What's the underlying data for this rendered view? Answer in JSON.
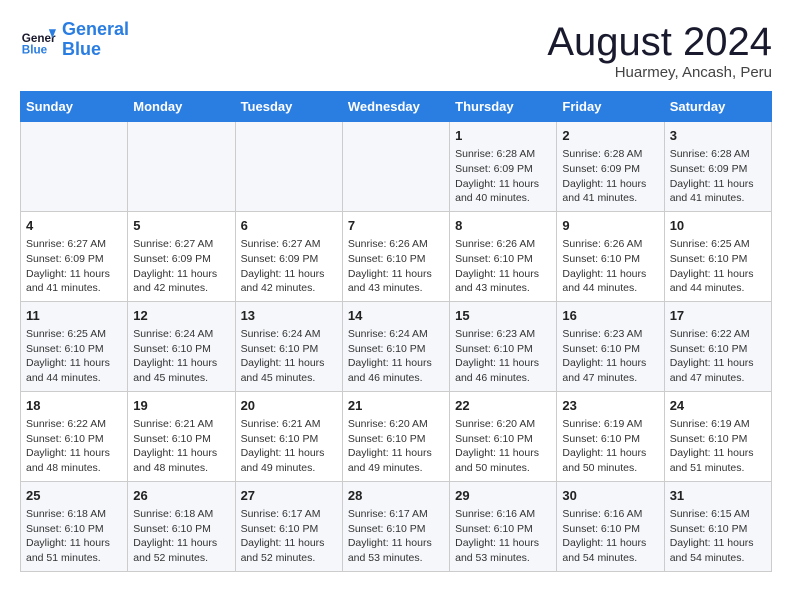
{
  "header": {
    "logo_line1": "General",
    "logo_line2": "Blue",
    "month_title": "August 2024",
    "subtitle": "Huarmey, Ancash, Peru"
  },
  "weekdays": [
    "Sunday",
    "Monday",
    "Tuesday",
    "Wednesday",
    "Thursday",
    "Friday",
    "Saturday"
  ],
  "weeks": [
    [
      {
        "day": "",
        "info": ""
      },
      {
        "day": "",
        "info": ""
      },
      {
        "day": "",
        "info": ""
      },
      {
        "day": "",
        "info": ""
      },
      {
        "day": "1",
        "info": "Sunrise: 6:28 AM\nSunset: 6:09 PM\nDaylight: 11 hours and 40 minutes."
      },
      {
        "day": "2",
        "info": "Sunrise: 6:28 AM\nSunset: 6:09 PM\nDaylight: 11 hours and 41 minutes."
      },
      {
        "day": "3",
        "info": "Sunrise: 6:28 AM\nSunset: 6:09 PM\nDaylight: 11 hours and 41 minutes."
      }
    ],
    [
      {
        "day": "4",
        "info": "Sunrise: 6:27 AM\nSunset: 6:09 PM\nDaylight: 11 hours and 41 minutes."
      },
      {
        "day": "5",
        "info": "Sunrise: 6:27 AM\nSunset: 6:09 PM\nDaylight: 11 hours and 42 minutes."
      },
      {
        "day": "6",
        "info": "Sunrise: 6:27 AM\nSunset: 6:09 PM\nDaylight: 11 hours and 42 minutes."
      },
      {
        "day": "7",
        "info": "Sunrise: 6:26 AM\nSunset: 6:10 PM\nDaylight: 11 hours and 43 minutes."
      },
      {
        "day": "8",
        "info": "Sunrise: 6:26 AM\nSunset: 6:10 PM\nDaylight: 11 hours and 43 minutes."
      },
      {
        "day": "9",
        "info": "Sunrise: 6:26 AM\nSunset: 6:10 PM\nDaylight: 11 hours and 44 minutes."
      },
      {
        "day": "10",
        "info": "Sunrise: 6:25 AM\nSunset: 6:10 PM\nDaylight: 11 hours and 44 minutes."
      }
    ],
    [
      {
        "day": "11",
        "info": "Sunrise: 6:25 AM\nSunset: 6:10 PM\nDaylight: 11 hours and 44 minutes."
      },
      {
        "day": "12",
        "info": "Sunrise: 6:24 AM\nSunset: 6:10 PM\nDaylight: 11 hours and 45 minutes."
      },
      {
        "day": "13",
        "info": "Sunrise: 6:24 AM\nSunset: 6:10 PM\nDaylight: 11 hours and 45 minutes."
      },
      {
        "day": "14",
        "info": "Sunrise: 6:24 AM\nSunset: 6:10 PM\nDaylight: 11 hours and 46 minutes."
      },
      {
        "day": "15",
        "info": "Sunrise: 6:23 AM\nSunset: 6:10 PM\nDaylight: 11 hours and 46 minutes."
      },
      {
        "day": "16",
        "info": "Sunrise: 6:23 AM\nSunset: 6:10 PM\nDaylight: 11 hours and 47 minutes."
      },
      {
        "day": "17",
        "info": "Sunrise: 6:22 AM\nSunset: 6:10 PM\nDaylight: 11 hours and 47 minutes."
      }
    ],
    [
      {
        "day": "18",
        "info": "Sunrise: 6:22 AM\nSunset: 6:10 PM\nDaylight: 11 hours and 48 minutes."
      },
      {
        "day": "19",
        "info": "Sunrise: 6:21 AM\nSunset: 6:10 PM\nDaylight: 11 hours and 48 minutes."
      },
      {
        "day": "20",
        "info": "Sunrise: 6:21 AM\nSunset: 6:10 PM\nDaylight: 11 hours and 49 minutes."
      },
      {
        "day": "21",
        "info": "Sunrise: 6:20 AM\nSunset: 6:10 PM\nDaylight: 11 hours and 49 minutes."
      },
      {
        "day": "22",
        "info": "Sunrise: 6:20 AM\nSunset: 6:10 PM\nDaylight: 11 hours and 50 minutes."
      },
      {
        "day": "23",
        "info": "Sunrise: 6:19 AM\nSunset: 6:10 PM\nDaylight: 11 hours and 50 minutes."
      },
      {
        "day": "24",
        "info": "Sunrise: 6:19 AM\nSunset: 6:10 PM\nDaylight: 11 hours and 51 minutes."
      }
    ],
    [
      {
        "day": "25",
        "info": "Sunrise: 6:18 AM\nSunset: 6:10 PM\nDaylight: 11 hours and 51 minutes."
      },
      {
        "day": "26",
        "info": "Sunrise: 6:18 AM\nSunset: 6:10 PM\nDaylight: 11 hours and 52 minutes."
      },
      {
        "day": "27",
        "info": "Sunrise: 6:17 AM\nSunset: 6:10 PM\nDaylight: 11 hours and 52 minutes."
      },
      {
        "day": "28",
        "info": "Sunrise: 6:17 AM\nSunset: 6:10 PM\nDaylight: 11 hours and 53 minutes."
      },
      {
        "day": "29",
        "info": "Sunrise: 6:16 AM\nSunset: 6:10 PM\nDaylight: 11 hours and 53 minutes."
      },
      {
        "day": "30",
        "info": "Sunrise: 6:16 AM\nSunset: 6:10 PM\nDaylight: 11 hours and 54 minutes."
      },
      {
        "day": "31",
        "info": "Sunrise: 6:15 AM\nSunset: 6:10 PM\nDaylight: 11 hours and 54 minutes."
      }
    ]
  ]
}
